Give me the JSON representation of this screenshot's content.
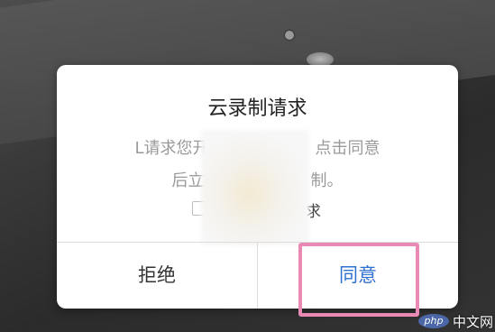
{
  "dialog": {
    "title": "云录制请求",
    "message_line1_left": "L请求您开",
    "message_line1_right": "点击同意",
    "message_line2_left": "后立",
    "message_line2_right": "制。",
    "checkbox_label_fragment": "求",
    "reject_label": "拒绝",
    "agree_label": "同意"
  },
  "watermark": {
    "logo_text": "php",
    "site_text": "中文网"
  },
  "colors": {
    "agree_text": "#2f6fd0",
    "highlight_border": "#e98ab4"
  }
}
